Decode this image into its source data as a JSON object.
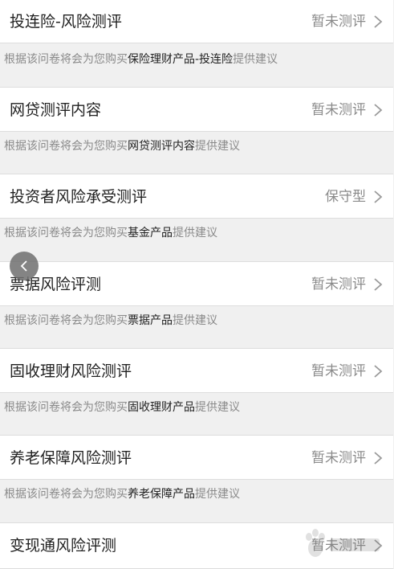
{
  "items": [
    {
      "title": "投连险-风险测评",
      "status": "暂未测评",
      "note_prefix": "根据该问卷将会为您购买",
      "product": "保险理财产品-投连险",
      "note_suffix": "提供建议"
    },
    {
      "title": "网贷测评内容",
      "status": "暂未测评",
      "note_prefix": "根据该问卷将会为您购买",
      "product": "网贷测评内容",
      "note_suffix": "提供建议"
    },
    {
      "title": "投资者风险承受测评",
      "status": "保守型",
      "note_prefix": "根据该问卷将会为您购买",
      "product": "基金产品",
      "note_suffix": "提供建议"
    },
    {
      "title": "票据风险评测",
      "status": "暂未测评",
      "note_prefix": "根据该问卷将会为您购买",
      "product": "票据产品",
      "note_suffix": "提供建议"
    },
    {
      "title": "固收理财风险测评",
      "status": "暂未测评",
      "note_prefix": "根据该问卷将会为您购买",
      "product": "固收理财产品",
      "note_suffix": "提供建议"
    },
    {
      "title": "养老保障风险测评",
      "status": "暂未测评",
      "note_prefix": "根据该问卷将会为您购买",
      "product": "养老保障产品",
      "note_suffix": "提供建议"
    },
    {
      "title": "变现通风险评测",
      "status": "暂未测评"
    }
  ],
  "icons": {
    "chevron": "chevron-right-icon",
    "back": "chevron-left-icon",
    "watermark": "baidu-paw-icon"
  },
  "colors": {
    "page_bg": "#f0f0f0",
    "card_bg": "#ffffff",
    "title_text": "#222222",
    "muted_text": "#8a8a8a",
    "back_button": "#6e6e6e"
  }
}
